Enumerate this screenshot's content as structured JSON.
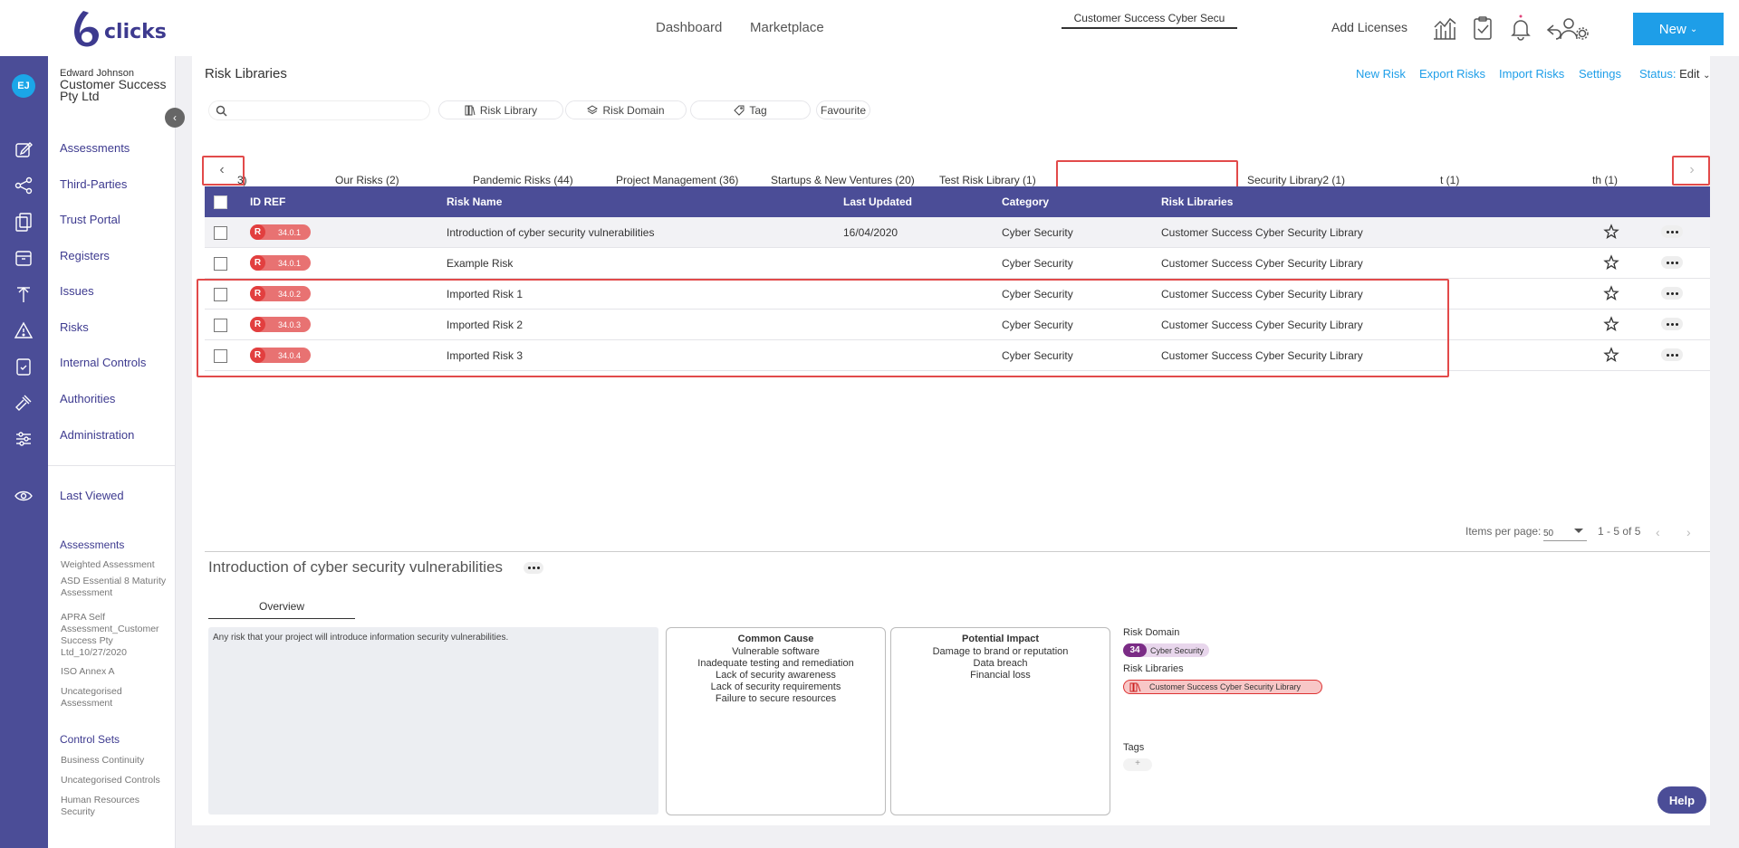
{
  "brand": {
    "name": "clicks",
    "logo_glyph": "6",
    "accent": "#4b4d97",
    "link_color": "#1e9ee8"
  },
  "topnav": {
    "dashboard": "Dashboard",
    "marketplace": "Marketplace",
    "add_licenses": "Add Licenses",
    "new_button": "New"
  },
  "user": {
    "initials": "EJ",
    "name": "Edward Johnson",
    "org": "Customer Success Pty Ltd"
  },
  "sidebar": {
    "items": [
      {
        "label": "Assessments",
        "icon": "edit-icon"
      },
      {
        "label": "Third-Parties",
        "icon": "network-icon"
      },
      {
        "label": "Trust Portal",
        "icon": "documents-icon"
      },
      {
        "label": "Registers",
        "icon": "register-icon"
      },
      {
        "label": "Issues",
        "icon": "issues-icon"
      },
      {
        "label": "Risks",
        "icon": "warning-icon"
      },
      {
        "label": "Internal Controls",
        "icon": "controls-icon"
      },
      {
        "label": "Authorities",
        "icon": "gavel-icon"
      },
      {
        "label": "Administration",
        "icon": "sliders-icon"
      }
    ],
    "last_viewed": "Last Viewed",
    "assessments_heading": "Assessments",
    "assessments": [
      "Weighted Assessment",
      "ASD Essential 8 Maturity Assessment",
      "APRA Self Assessment_Customer Success Pty Ltd_10/27/2020",
      "ISO Annex A",
      "Uncategorised Assessment"
    ],
    "control_sets_heading": "Control Sets",
    "control_sets": [
      "Business Continuity",
      "Uncategorised Controls",
      "Human Resources Security"
    ]
  },
  "page": {
    "title": "Risk Libraries",
    "actions": [
      "New Risk",
      "Export Risks",
      "Import Risks",
      "Settings"
    ],
    "status_label": "Status:",
    "status_value": "Edit"
  },
  "filters": {
    "search_placeholder": "",
    "risk_library": "Risk Library",
    "risk_domain": "Risk Domain",
    "tag": "Tag",
    "favourite": "Favourite"
  },
  "tabs": [
    {
      "label": "3)"
    },
    {
      "label": "Our Risks (2)"
    },
    {
      "label": "Pandemic Risks (44)"
    },
    {
      "label": "Project Management (36)"
    },
    {
      "label": "Startups & New Ventures (20)"
    },
    {
      "label": "Test Risk Library (1)"
    },
    {
      "label": "Customer Success Cyber Secu"
    },
    {
      "label": "Security Library2 (1)"
    },
    {
      "label": "t (1)"
    },
    {
      "label": "th (1)"
    }
  ],
  "table": {
    "headers": [
      "ID REF",
      "Risk Name",
      "Last Updated",
      "Category",
      "Risk Libraries"
    ],
    "badge_letter": "R",
    "rows": [
      {
        "id": "34.0.1",
        "name": "Introduction of cyber security vulnerabilities",
        "updated": "16/04/2020",
        "category": "Cyber Security",
        "library": "Customer Success Cyber Security Library"
      },
      {
        "id": "34.0.1",
        "name": "Example Risk",
        "updated": "",
        "category": "Cyber Security",
        "library": "Customer Success Cyber Security Library"
      },
      {
        "id": "34.0.2",
        "name": "Imported Risk 1",
        "updated": "",
        "category": "Cyber Security",
        "library": "Customer Success Cyber Security Library"
      },
      {
        "id": "34.0.3",
        "name": "Imported Risk 2",
        "updated": "",
        "category": "Cyber Security",
        "library": "Customer Success Cyber Security Library"
      },
      {
        "id": "34.0.4",
        "name": "Imported Risk 3",
        "updated": "",
        "category": "Cyber Security",
        "library": "Customer Success Cyber Security Library"
      }
    ]
  },
  "pager": {
    "items_label": "Items per page:",
    "per_page": "50",
    "range": "1 - 5 of 5"
  },
  "detail": {
    "title": "Introduction of cyber security vulnerabilities",
    "tab": "Overview",
    "description": "Any risk that your project will introduce information security vulnerabilities.",
    "common_cause": {
      "title": "Common Cause",
      "items": [
        "Vulnerable software",
        "Inadequate testing and remediation",
        "Lack of security awareness",
        "Lack of security requirements",
        "Failure to secure resources"
      ]
    },
    "potential_impact": {
      "title": "Potential Impact",
      "items": [
        "Damage to brand or reputation",
        "Data breach",
        "Financial loss"
      ]
    },
    "risk_domain_label": "Risk Domain",
    "risk_domain_num": "34",
    "risk_domain_name": "Cyber Security",
    "risk_libraries_label": "Risk Libraries",
    "risk_library": "Customer Success Cyber Security Library",
    "tags_label": "Tags",
    "tag_add": "+"
  },
  "help": "Help"
}
